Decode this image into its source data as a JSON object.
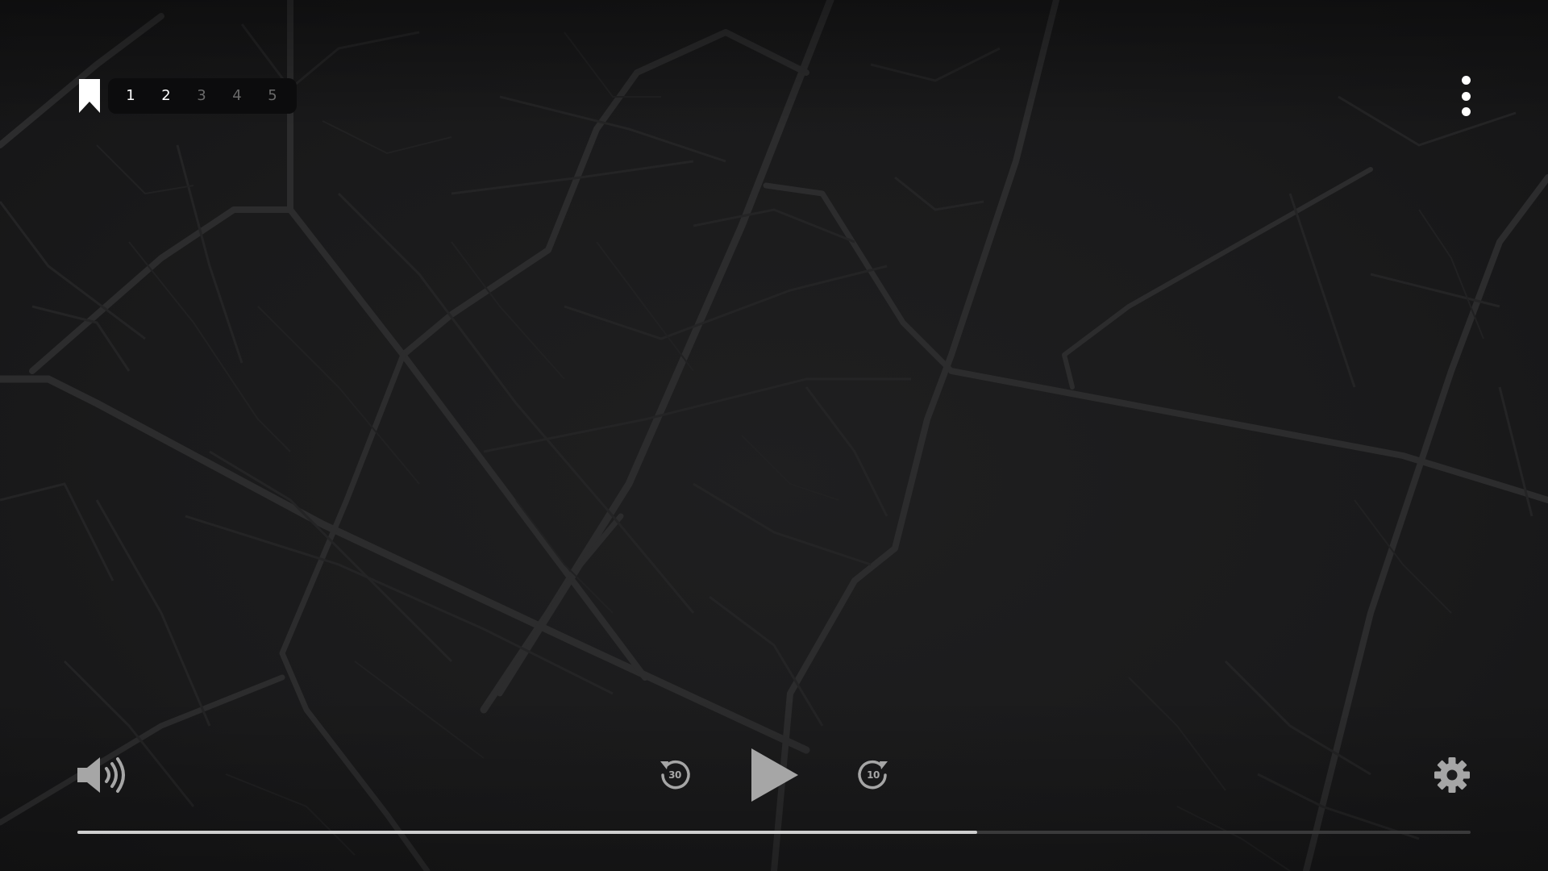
{
  "player": {
    "progress_fraction": 0.646,
    "colors": {
      "background": "#1b1b1c",
      "map_lines": "#2a2a2b",
      "control_icon": "#a6a6a6",
      "progress_fill": "#cfcfcf",
      "progress_track": "#3a3a3b",
      "chapter_active": "#ffffff",
      "chapter_dim": "#6a6a6a"
    }
  },
  "top_bar": {
    "bookmark_icon": "bookmark-icon",
    "chapters": [
      {
        "label": "1",
        "state": "active"
      },
      {
        "label": "2",
        "state": "active"
      },
      {
        "label": "3",
        "state": "dim"
      },
      {
        "label": "4",
        "state": "dim"
      },
      {
        "label": "5",
        "state": "dim"
      }
    ],
    "menu_icon": "more-vertical-icon"
  },
  "controls": {
    "volume_icon": "volume-icon",
    "rewind_label": "30",
    "rewind_icon": "rewind-30-icon",
    "play_icon": "play-icon",
    "forward_label": "10",
    "forward_icon": "forward-10-icon",
    "settings_icon": "gear-icon"
  }
}
